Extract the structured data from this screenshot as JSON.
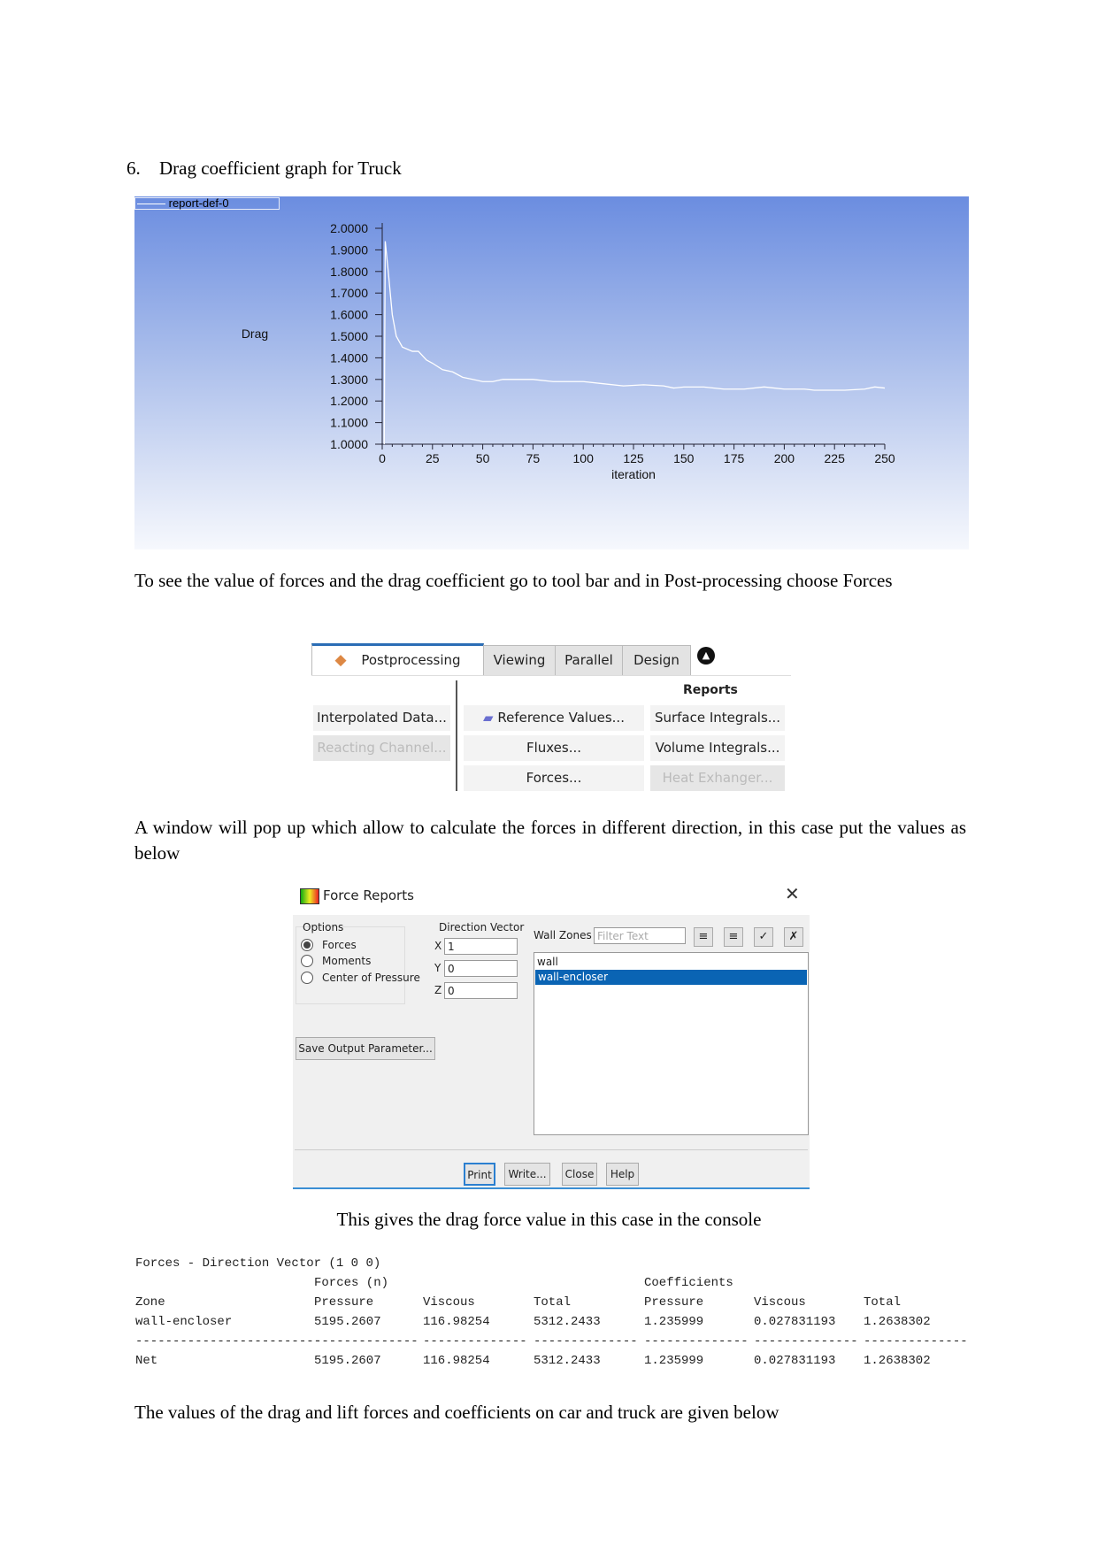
{
  "heading": {
    "number": "6.",
    "text": "Drag coefficient graph for Truck"
  },
  "chart_data": {
    "type": "line",
    "legend_entry": "report-def-0",
    "legend_placement": "top-left",
    "ylabel": "Drag",
    "xlabel": "iteration",
    "xlim": [
      0,
      250
    ],
    "ylim": [
      1.0,
      2.0
    ],
    "x_ticks": [
      "0",
      "25",
      "50",
      "75",
      "100",
      "125",
      "150",
      "175",
      "200",
      "225",
      "250"
    ],
    "y_ticks": [
      "2.0000",
      "1.9000",
      "1.8000",
      "1.7000",
      "1.6000",
      "1.5000",
      "1.4000",
      "1.3000",
      "1.2000",
      "1.1000",
      "1.0000"
    ],
    "grid": false,
    "line_color": "#ffffff",
    "series": [
      {
        "x": [
          1,
          1.5,
          3,
          5,
          7,
          10,
          15,
          18,
          22,
          25,
          30,
          35,
          40,
          45,
          50,
          55,
          60,
          75,
          85,
          100,
          110,
          120,
          130,
          140,
          145,
          150,
          160,
          170,
          180,
          190,
          200,
          210,
          215,
          230,
          240,
          245,
          250
        ],
        "y": [
          1.0,
          1.94,
          1.8,
          1.6,
          1.5,
          1.45,
          1.43,
          1.43,
          1.39,
          1.375,
          1.345,
          1.335,
          1.31,
          1.3,
          1.29,
          1.29,
          1.3,
          1.3,
          1.29,
          1.29,
          1.28,
          1.27,
          1.275,
          1.27,
          1.26,
          1.265,
          1.265,
          1.255,
          1.255,
          1.265,
          1.255,
          1.255,
          1.25,
          1.25,
          1.255,
          1.265,
          1.26
        ]
      }
    ]
  },
  "para1": "To see the value of forces and the drag coefficient go to tool bar and in Post-processing choose Forces",
  "toolbar": {
    "tabs": [
      "Postprocessing",
      "Viewing",
      "Parallel",
      "Design"
    ],
    "section_title": "Reports",
    "items": {
      "interpolated": "Interpolated Data...",
      "reacting": "Reacting Channel...",
      "reference": "Reference Values...",
      "fluxes": "Fluxes...",
      "forces": "Forces...",
      "surface": "Surface Integrals...",
      "volume": "Volume Integrals...",
      "heat": "Heat Exhanger..."
    }
  },
  "para2": "A window will pop up which allow to calculate the forces in different direction, in this case put the values as below",
  "dialog": {
    "title": "Force Reports",
    "options_label": "Options",
    "options": [
      "Forces",
      "Moments",
      "Center of Pressure"
    ],
    "selected_option": "Forces",
    "direction_label": "Direction Vector",
    "x_label": "X",
    "y_label": "Y",
    "z_label": "Z",
    "x": "1",
    "y": "0",
    "z": "0",
    "wall_zones_label": "Wall Zones",
    "filter_placeholder": "Filter Text",
    "zones": [
      "wall",
      "wall-encloser"
    ],
    "selected_zone": "wall-encloser",
    "save_output": "Save Output Parameter...",
    "buttons": [
      "Print",
      "Write...",
      "Close",
      "Help"
    ],
    "accent": "#0a64b4"
  },
  "para3": "This gives the drag force value in this case in the console",
  "console": {
    "title": "Forces - Direction Vector (1 0 0)",
    "group_forces": "Forces (n)",
    "group_coeffs": "Coefficients",
    "headers": [
      "Zone",
      "Pressure",
      "Viscous",
      "Total",
      "Pressure",
      "Viscous",
      "Total"
    ],
    "rows": [
      [
        "wall-encloser",
        "5195.2607",
        "116.98254",
        "5312.2433",
        "1.235999",
        "0.027831193",
        "1.2638302"
      ]
    ],
    "separator": [
      "-------------------------",
      "--------------",
      "--------------",
      "--------------",
      "--------------",
      "--------------",
      "--------------"
    ],
    "net": [
      "Net",
      "5195.2607",
      "116.98254",
      "5312.2433",
      "1.235999",
      "0.027831193",
      "1.2638302"
    ]
  },
  "para4": "The values of the drag and lift forces and coefficients on car and truck are given below"
}
